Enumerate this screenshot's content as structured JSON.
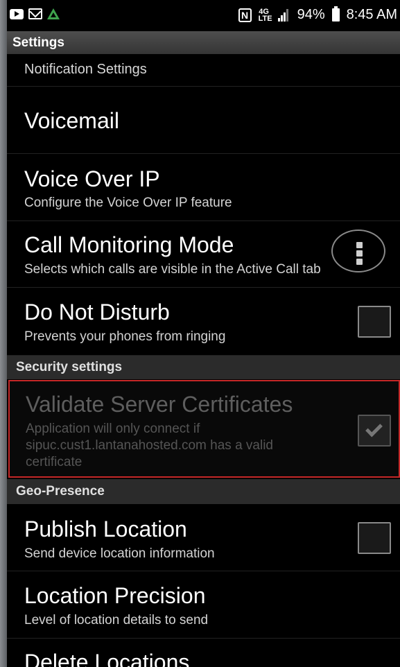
{
  "status_bar": {
    "battery": "94%",
    "time": "8:45 AM",
    "network_label": "4G",
    "network_sublabel": "LTE",
    "icons": [
      "video-icon",
      "mail-icon",
      "drive-icon",
      "nfc-icon",
      "lte-icon",
      "signal-icon",
      "battery-icon"
    ]
  },
  "header": {
    "title": "Settings"
  },
  "items": {
    "notification": {
      "title": "Notification Settings"
    },
    "voicemail": {
      "title": "Voicemail"
    },
    "voip": {
      "title": "Voice Over IP",
      "subtitle": "Configure the Voice Over IP feature"
    },
    "call_monitoring": {
      "title": "Call Monitoring Mode",
      "subtitle": "Selects which calls are visible in the Active Call tab"
    },
    "dnd": {
      "title": "Do Not Disturb",
      "subtitle": "Prevents your phones from ringing",
      "checked": false
    },
    "validate_certs": {
      "title": "Validate Server Certificates",
      "subtitle_line1": "Application will only connect if",
      "subtitle_line2": "sipuc.cust1.lantanahosted.com has a valid",
      "subtitle_line3": "certificate",
      "checked": true,
      "enabled": false
    },
    "publish_location": {
      "title": "Publish Location",
      "subtitle": "Send device location information",
      "checked": false
    },
    "location_precision": {
      "title": "Location Precision",
      "subtitle": "Level of location details to send"
    },
    "delete_locations": {
      "title": "Delete Locations"
    }
  },
  "sections": {
    "security": "Security settings",
    "geo": "Geo-Presence"
  },
  "colors": {
    "background": "#000000",
    "highlight_border": "#c62828",
    "section_bg": "#2b2b2b",
    "drive_icon": "#3fa34d"
  }
}
